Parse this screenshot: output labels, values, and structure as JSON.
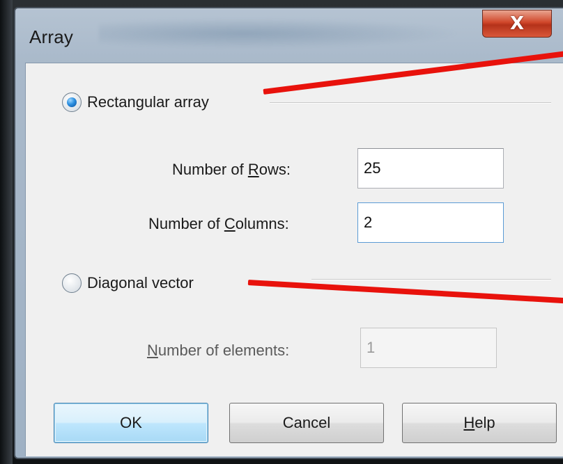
{
  "window": {
    "title": "Array",
    "close_glyph": "X"
  },
  "options": {
    "rectangular": {
      "label": "Rectangular array",
      "selected": true
    },
    "diagonal": {
      "label": "Diagonal vector",
      "selected": false
    }
  },
  "fields": {
    "rows": {
      "label_prefix": "Number of ",
      "label_accel": "R",
      "label_rest": "ows:",
      "value": "25"
    },
    "columns": {
      "label_prefix": "Number of ",
      "label_accel": "C",
      "label_rest": "olumns:",
      "value": "2"
    },
    "elements": {
      "label_prefix": "",
      "label_accel": "N",
      "label_rest": "umber of elements:",
      "value": "1",
      "disabled": true
    }
  },
  "buttons": {
    "ok": "OK",
    "cancel": "Cancel",
    "help_accel": "H",
    "help_rest": "elp"
  },
  "colors": {
    "annotation": "#e8120c",
    "radio_selected": "#2b8fe0"
  }
}
